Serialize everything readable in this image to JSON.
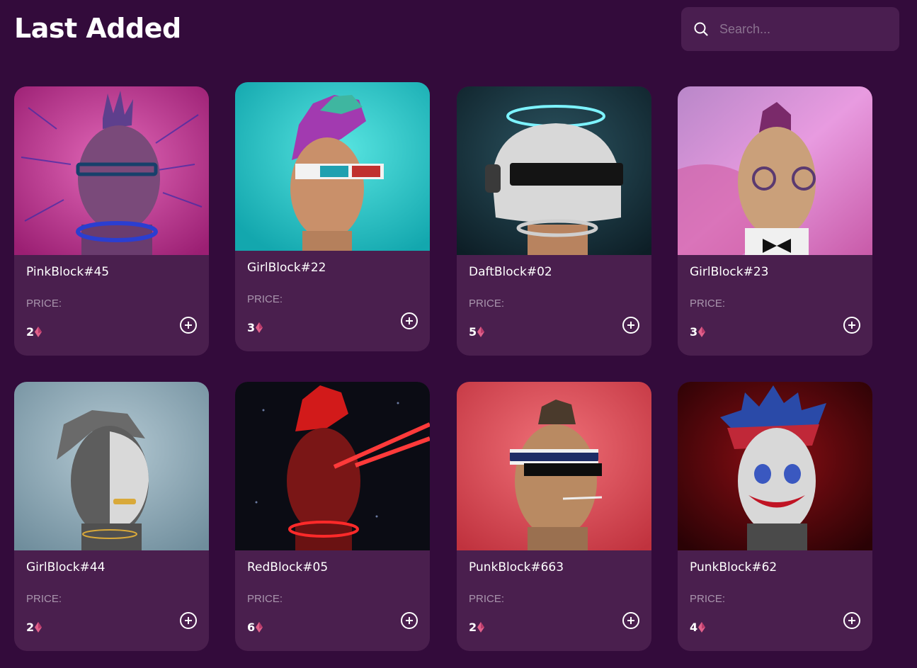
{
  "header": {
    "title": "Last Added"
  },
  "search": {
    "placeholder": "Search...",
    "icon": "search-icon"
  },
  "currency_icon": "eth-icon",
  "cards": [
    {
      "name": "PinkBlock#45",
      "price_label": "PRICE:",
      "price": "2",
      "bg": "#c23a90"
    },
    {
      "name": "GirlBlock#22",
      "price_label": "PRICE:",
      "price": "3",
      "bg": "#22c6c9"
    },
    {
      "name": "DaftBlock#02",
      "price_label": "PRICE:",
      "price": "5",
      "bg": "#17333c"
    },
    {
      "name": "GirlBlock#23",
      "price_label": "PRICE:",
      "price": "3",
      "bg": "#d88fd0"
    },
    {
      "name": "GirlBlock#44",
      "price_label": "PRICE:",
      "price": "2",
      "bg": "#8fa9b6"
    },
    {
      "name": "RedBlock#05",
      "price_label": "PRICE:",
      "price": "6",
      "bg": "#0c0c14"
    },
    {
      "name": "PunkBlock#663",
      "price_label": "PRICE:",
      "price": "2",
      "bg": "#d8505c"
    },
    {
      "name": "PunkBlock#62",
      "price_label": "PRICE:",
      "price": "4",
      "bg": "#5a0508"
    }
  ],
  "colors": {
    "background": "#330b3b",
    "card": "#4a1f4e",
    "search_bg": "#4a1e50",
    "price_label": "#a995ad",
    "eth_accent": "#e0608a"
  }
}
